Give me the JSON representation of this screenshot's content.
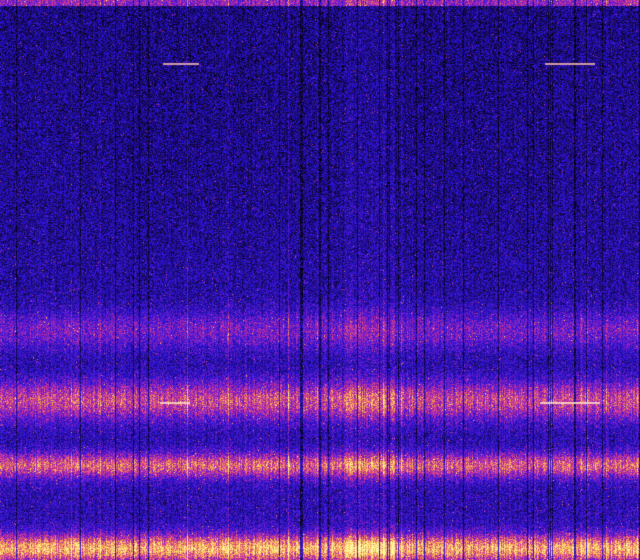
{
  "spectrogram": {
    "colormap": [
      "#000000",
      "#1a0a6e",
      "#2a14d8",
      "#7a1ec8",
      "#d83a8c",
      "#f5b04a",
      "#fff8a0"
    ]
  }
}
